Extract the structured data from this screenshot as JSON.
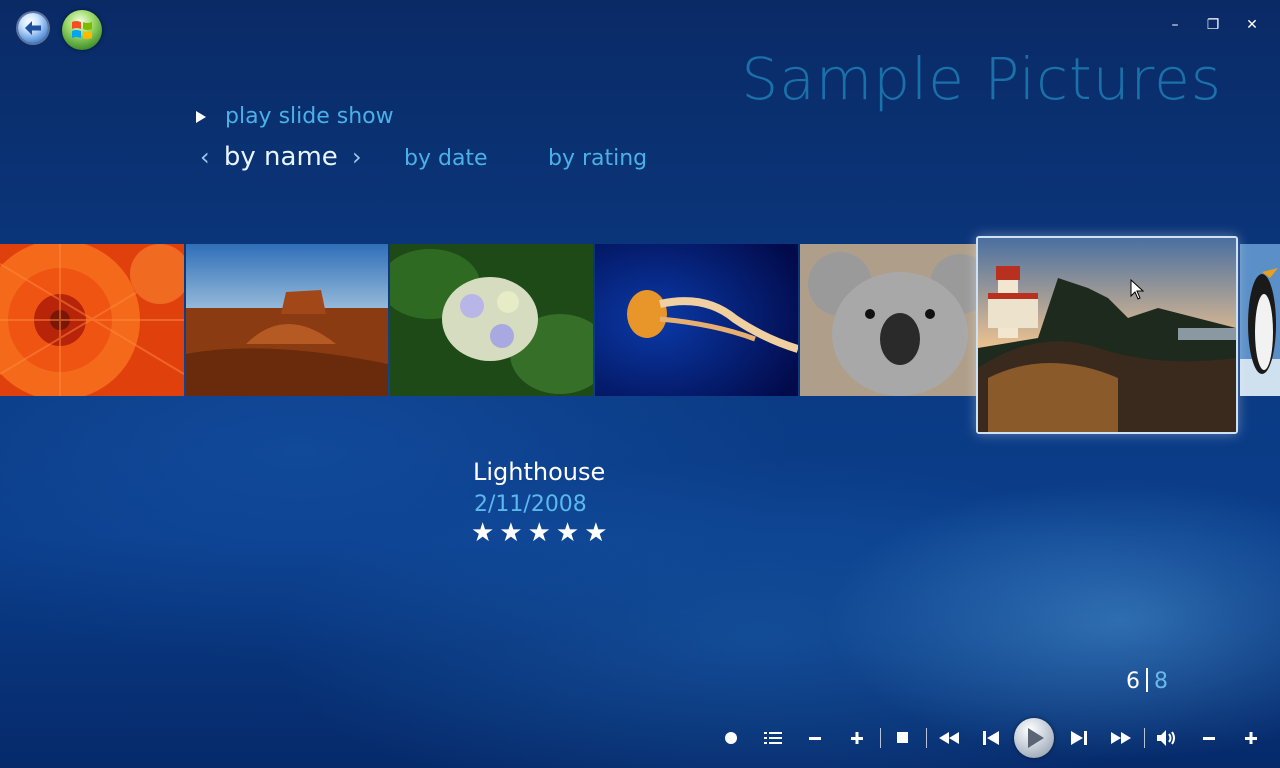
{
  "window": {
    "minimize_glyph": "–",
    "restore_glyph": "❐",
    "close_glyph": "✕"
  },
  "header": {
    "title": "Sample Pictures"
  },
  "menu": {
    "play_slide_show": "play slide show",
    "sort_active": "by name",
    "sort_prev_glyph": "‹",
    "sort_next_glyph": "›",
    "sort_options": [
      "by date",
      "by rating"
    ]
  },
  "gallery": {
    "items": [
      {
        "icon": "chrysanthemum-photo"
      },
      {
        "icon": "desert-photo"
      },
      {
        "icon": "hydrangeas-photo"
      },
      {
        "icon": "jellyfish-photo"
      },
      {
        "icon": "koala-photo"
      },
      {
        "icon": "lighthouse-photo"
      },
      {
        "icon": "penguins-photo"
      }
    ],
    "selected_index": 5
  },
  "details": {
    "title": "Lighthouse",
    "date": "2/11/2008",
    "stars": "★★★★★",
    "rating": 5
  },
  "counter": {
    "current": "6",
    "total": "8"
  },
  "transport": {
    "icons": [
      "record-icon",
      "guide-icon",
      "channel-down-icon",
      "channel-up-icon",
      "stop-icon",
      "rewind-icon",
      "previous-icon",
      "play-icon",
      "next-icon",
      "fast-forward-icon",
      "volume-icon",
      "volume-down-icon",
      "volume-up-icon"
    ]
  },
  "colors": {
    "accent": "#4ab0e8",
    "title_faint": "#28aadc"
  }
}
